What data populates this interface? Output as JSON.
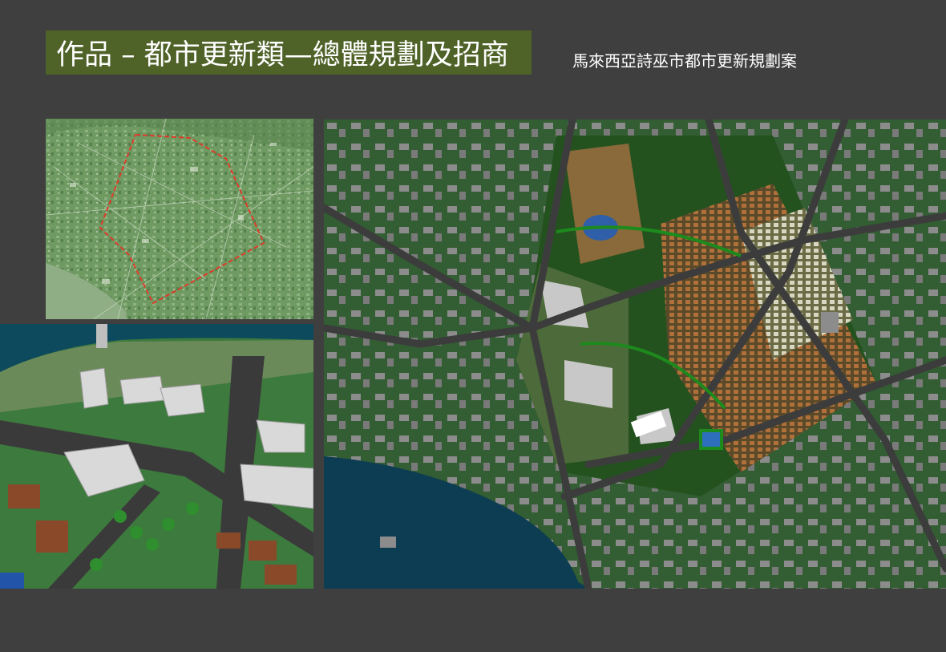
{
  "slide": {
    "title": "作品 – 都市更新類—總體規劃及招商",
    "subtitle": "馬來西亞詩巫市都市更新規劃案"
  },
  "colors": {
    "background": "#3f3f3f",
    "title_box": "#4f6228",
    "text": "#ffffff",
    "boundary_line": "#e03a2a",
    "water": "#0d3d52",
    "ground": "#335d33"
  },
  "images": {
    "site_map": "satellite-site-map-with-red-boundary",
    "aerial_render": "3d-aerial-rendering-of-district",
    "master_plan": "urban-renewal-master-plan"
  }
}
